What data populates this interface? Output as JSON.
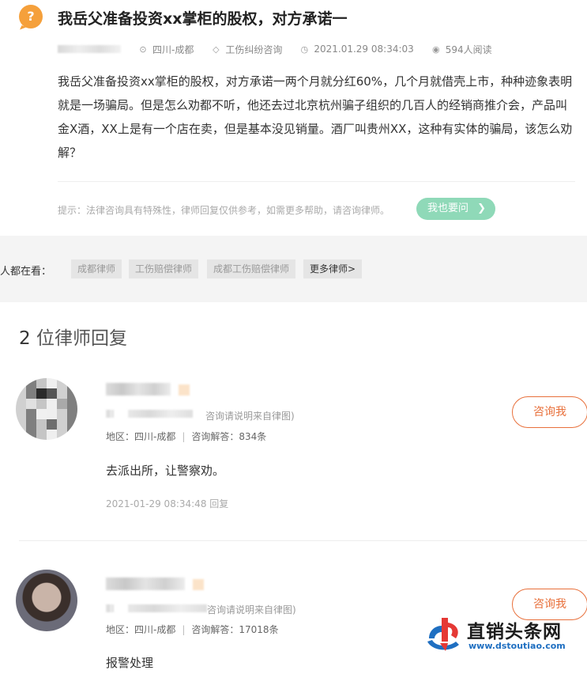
{
  "question": {
    "title": "我岳父准备投资xx掌柜的股权，对方承诺一",
    "location": "四川-成都",
    "category": "工伤纠纷咨询",
    "datetime": "2021.01.29 08:34:03",
    "views": "594人阅读",
    "body": "我岳父准备投资xx掌柜的股权，对方承诺一两个月就分红60%，几个月就借壳上市，种种迹象表明就是一场骗局。但是怎么劝都不听，他还去过北京杭州骗子组织的几百人的经销商推介会，产品叫金X酒，XX上是有一个店在卖，但是基本没见销量。酒厂叫贵州XX，这种有实体的骗局，该怎么劝解？"
  },
  "tip": {
    "text": "提示：法律咨询具有特殊性，律师回复仅供参考，如需更多帮助，请咨询律师。",
    "ask_button": "我也要问"
  },
  "others": {
    "label": "他人都在看：",
    "chips": [
      "成都律师",
      "工伤赔偿律师",
      "成都工伤赔偿律师"
    ],
    "more": "更多律师>"
  },
  "replies": {
    "count": "2",
    "heading": "位律师回复",
    "items": [
      {
        "cert_note": "咨询请说明来自律图)",
        "region": "地区：四川-成都",
        "answers": "咨询解答：834条",
        "text": "去派出所，让警察劝。",
        "time": "2021-01-29 08:34:48 回复",
        "consult": "咨询我"
      },
      {
        "cert_note": "咨询请说明来自律图)",
        "region": "地区：四川-成都",
        "answers": "咨询解答：17018条",
        "text": "报警处理",
        "consult": "咨询我"
      }
    ]
  },
  "watermark": {
    "name": "直销头条网",
    "url": "www.dstoutiao.com"
  },
  "icons": {
    "question": "question-icon",
    "location": "location-pin-icon",
    "tag": "tag-icon",
    "clock": "clock-icon",
    "eye": "eye-icon",
    "chevron": "chevron-right-icon"
  },
  "colors": {
    "accent_orange": "#f5a03b",
    "ask_green": "#8fd9b8",
    "consult_border": "#e8703b",
    "watermark_blue": "#1f6fc1"
  }
}
